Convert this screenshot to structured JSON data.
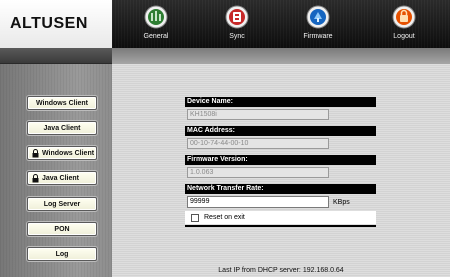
{
  "brand": {
    "name": "ALTUSEN"
  },
  "nav": {
    "items": [
      {
        "label": "General",
        "icon": "general-globe-icon",
        "color": "#2e7d32"
      },
      {
        "label": "Sync",
        "icon": "sync-icon",
        "color": "#c62828"
      },
      {
        "label": "Firmware",
        "icon": "firmware-icon",
        "color": "#1565c0"
      },
      {
        "label": "Logout",
        "icon": "logout-icon",
        "color": "#e65100"
      }
    ]
  },
  "sidebar": {
    "buttons": [
      {
        "label": "Windows Client",
        "icon": ""
      },
      {
        "label": "Java Client",
        "icon": ""
      },
      {
        "label": "Windows Client",
        "icon": "lock-icon"
      },
      {
        "label": "Java Client",
        "icon": "lock-icon"
      },
      {
        "label": "Log Server",
        "icon": ""
      },
      {
        "label": "PON",
        "icon": ""
      },
      {
        "label": "Log",
        "icon": ""
      }
    ]
  },
  "form": {
    "device_name": {
      "label": "Device Name:",
      "value": "KH1508i"
    },
    "mac_address": {
      "label": "MAC Address:",
      "value": "00-10-74-44-00-10"
    },
    "firmware_version": {
      "label": "Firmware Version:",
      "value": "1.0.063"
    },
    "network_transfer_rate": {
      "label": "Network Transfer Rate:",
      "value": "99999",
      "unit": "KBps"
    },
    "reset_on_exit": {
      "label": "Reset on exit",
      "checked": false
    }
  },
  "status": {
    "text": "Last IP from DHCP server: 192.168.0.64"
  }
}
